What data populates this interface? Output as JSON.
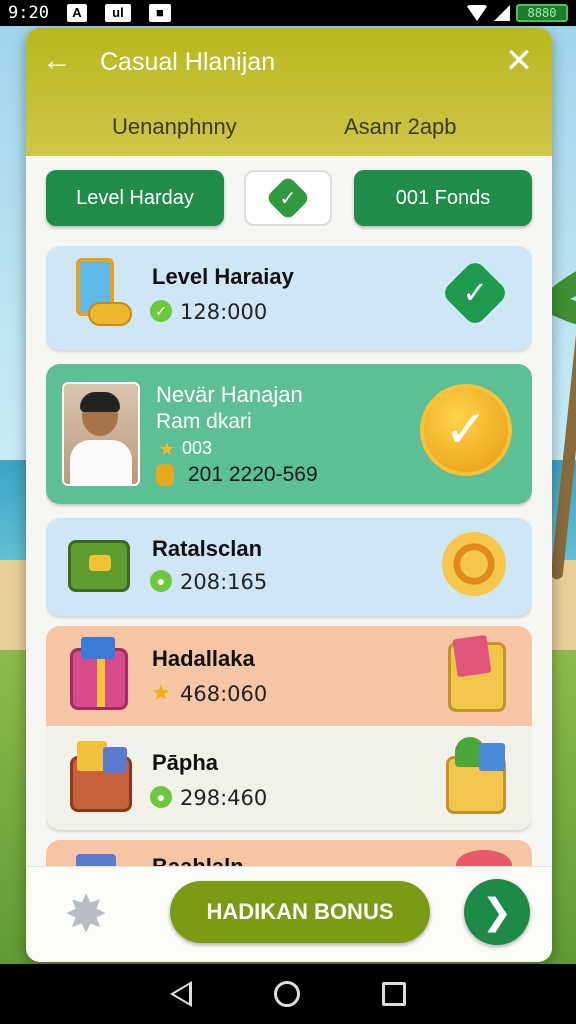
{
  "status_bar": {
    "time": "9:20",
    "icon_a": "A",
    "icon_b": "ul",
    "battery": "8880"
  },
  "dialog": {
    "title": "Casual Hlanijan",
    "subtitle_left": "Uenanphnny",
    "subtitle_right": "Asanr 2apb",
    "tabs": {
      "left": "Level Harday",
      "right": "001 Fonds"
    }
  },
  "list": [
    {
      "title": "Level Haraiay",
      "value": "128:000",
      "value_icon": "check-coin-icon"
    },
    {
      "title": "Nevär Hanajan",
      "subtitle": "Ram dkari",
      "line2": "003",
      "line3": "201 2220-569"
    },
    {
      "title": "Ratalsclan",
      "value": "208:165",
      "value_icon": "green-coin-icon"
    },
    {
      "title": "Hadallaka",
      "value": "468:060",
      "value_icon": "star-icon"
    },
    {
      "title": "Pāpha",
      "value": "298:460",
      "value_icon": "green-coin-icon"
    },
    {
      "title": "Baahlaln"
    }
  ],
  "bottom": {
    "bonus_label": "HADIKAN BONUS"
  },
  "colors": {
    "header": "#b8b81c",
    "primary_green": "#1f8c4a",
    "bonus_button": "#7d9a14"
  }
}
